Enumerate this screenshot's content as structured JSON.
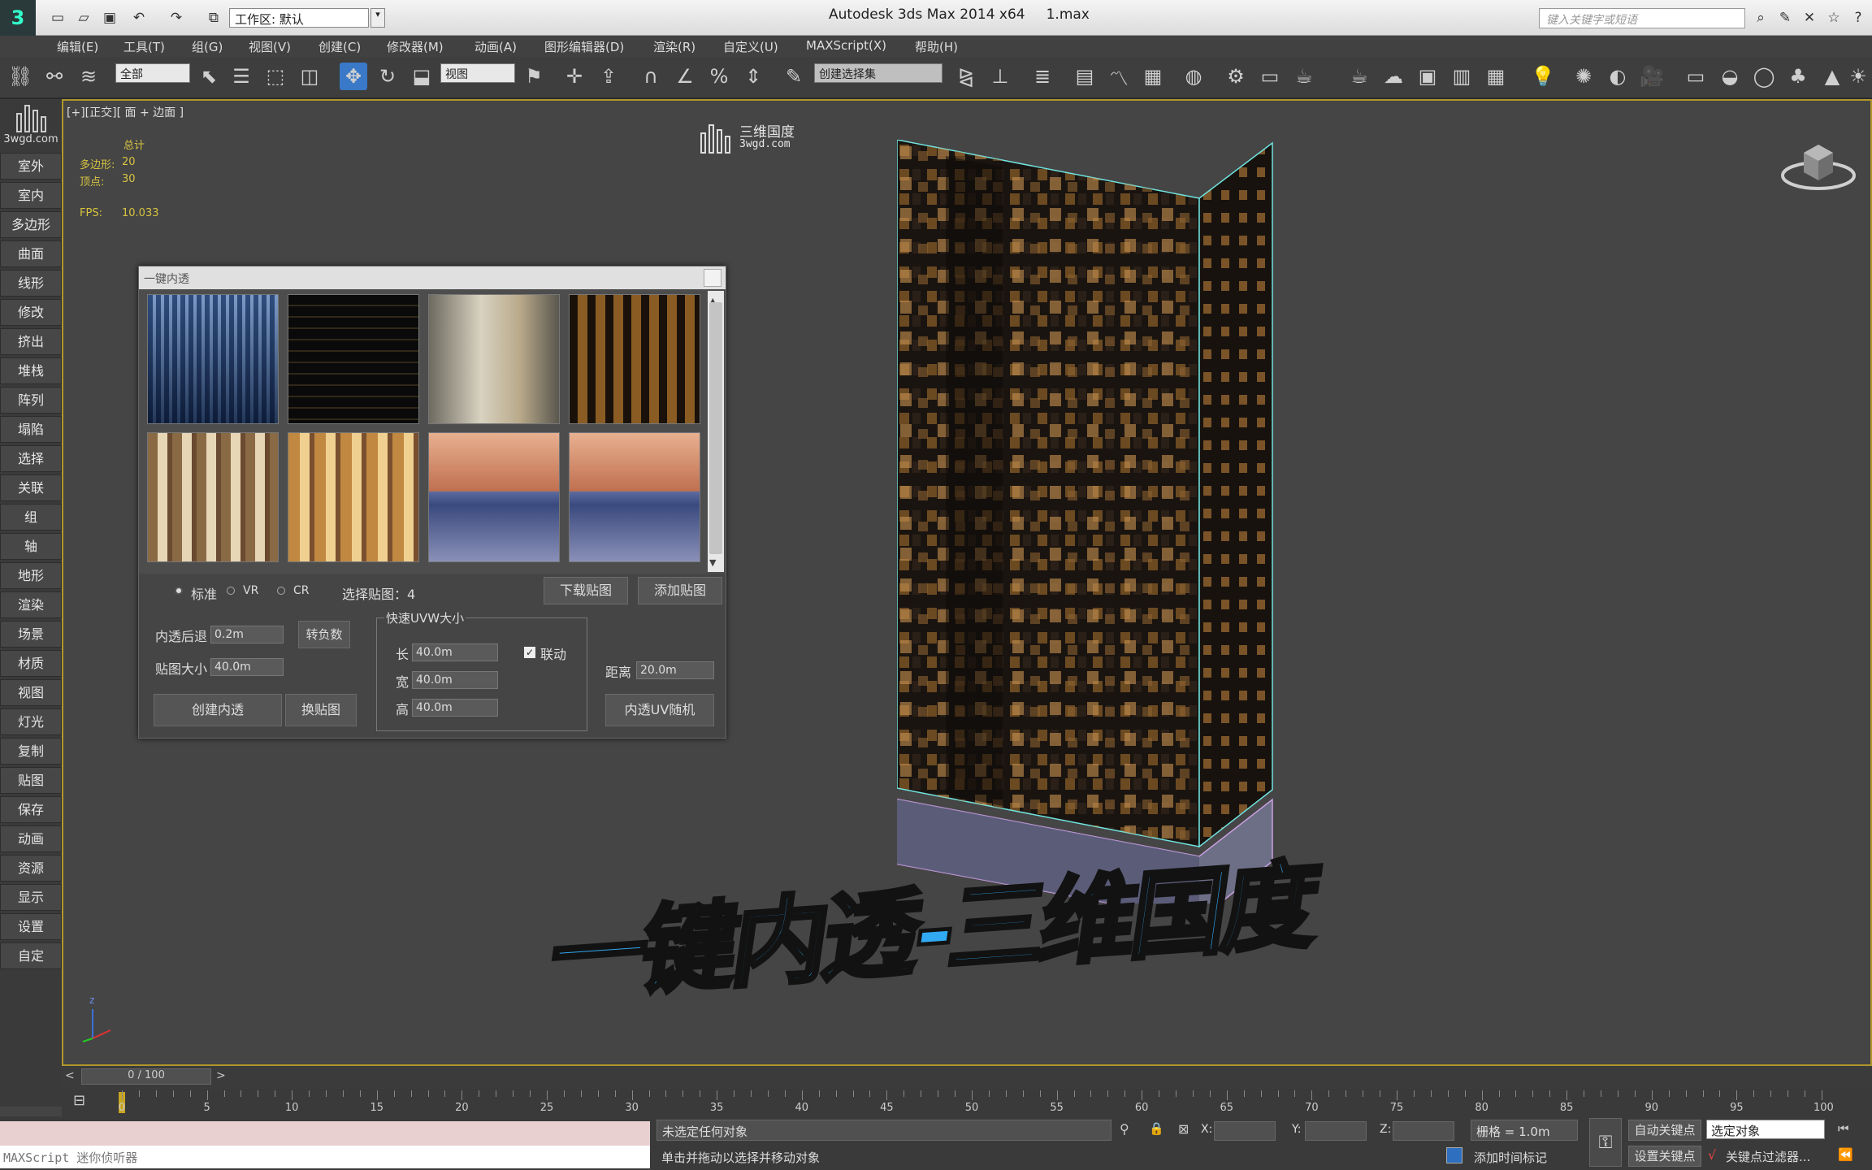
{
  "app": {
    "title": "Autodesk 3ds Max  2014 x64",
    "file": "1.max",
    "workspace": "工作区: 默认",
    "search_placeholder": "键入关键字或短语"
  },
  "menu": [
    "编辑(E)",
    "工具(T)",
    "组(G)",
    "视图(V)",
    "创建(C)",
    "修改器(M)",
    "动画(A)",
    "图形编辑器(D)",
    "渲染(R)",
    "自定义(U)",
    "MAXScript(X)",
    "帮助(H)"
  ],
  "toolbar": {
    "filter": "全部",
    "refcoord": "视图",
    "selset": "创建选择集"
  },
  "leftbar": {
    "logo_text": "3wgd.com",
    "items": [
      "室外",
      "室内",
      "多边形",
      "曲面",
      "线形",
      "修改",
      "挤出",
      "堆栈",
      "阵列",
      "塌陷",
      "选择",
      "关联",
      "组",
      "轴",
      "地形",
      "渲染",
      "场景",
      "材质",
      "视图",
      "灯光",
      "复制",
      "贴图",
      "保存",
      "动画",
      "资源",
      "显示",
      "设置",
      "自定"
    ]
  },
  "viewport": {
    "label": "[+][正交][ 面 + 边面 ]",
    "total": "总计",
    "polys_label": "多边形:",
    "polys": "20",
    "verts_label": "顶点:",
    "verts": "30",
    "fps_label": "FPS:",
    "fps": "10.033",
    "watermark": "三维国度",
    "watermark_sub": "3wgd.com",
    "axis_label": "z"
  },
  "dialog": {
    "title": "一键内透",
    "radio": [
      "标准",
      "VR",
      "CR"
    ],
    "selected": "选择贴图：4",
    "download": "下载贴图",
    "add": "添加贴图",
    "offset_label": "内透后退",
    "offset": "0.2m",
    "to_neg": "转负数",
    "size_label": "贴图大小",
    "size": "40.0m",
    "create": "创建内透",
    "swap": "换贴图",
    "uvw_group": "快速UVW大小",
    "len_label": "长",
    "len": "40.0m",
    "wid_label": "宽",
    "wid": "40.0m",
    "hei_label": "高",
    "hei": "40.0m",
    "link": "联动",
    "dist_label": "距离",
    "dist": "20.0m",
    "random": "内透UV随机"
  },
  "overlay_title": "一键内透-三维国度",
  "timeline": {
    "frame": "0 / 100",
    "ticks": [
      "0",
      "5",
      "10",
      "15",
      "20",
      "25",
      "30",
      "35",
      "40",
      "45",
      "50",
      "55",
      "60",
      "65",
      "70",
      "75",
      "80",
      "85",
      "90",
      "95",
      "100"
    ]
  },
  "status": {
    "maxscript": "MAXScript 迷你侦听器",
    "line1": "未选定任何对象",
    "line2": "单击并拖动以选择并移动对象",
    "x": "X:",
    "y": "Y:",
    "z": "Z:",
    "grid": "栅格 = 1.0m",
    "addtime": "添加时间标记",
    "autokey": "自动关键点",
    "setkey": "设置关键点",
    "keysel": "选定对象",
    "keyfilter": "关键点过滤器..."
  },
  "colors": {
    "accent": "#31a9f3",
    "viewport_border": "#b0962b"
  }
}
